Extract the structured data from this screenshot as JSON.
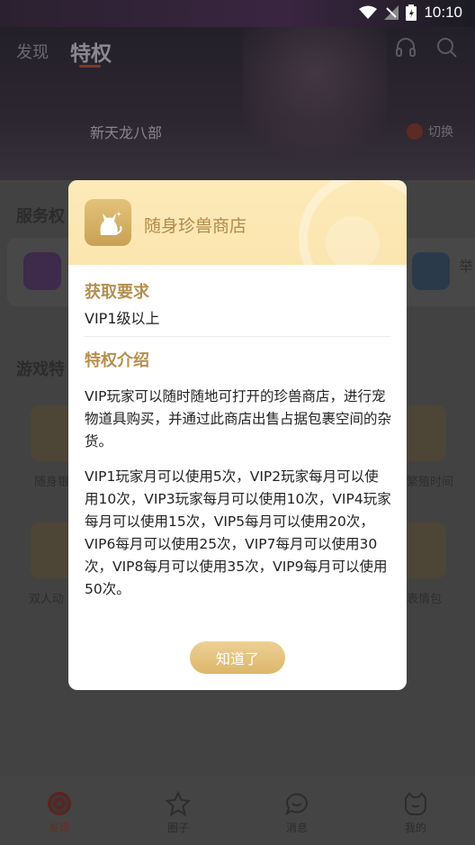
{
  "status_bar": {
    "time": "10:10"
  },
  "header": {
    "tabs": [
      {
        "label": "发现"
      },
      {
        "label": "特权"
      }
    ],
    "server_name": "新天龙八部",
    "switch_label": "切换"
  },
  "background": {
    "service_title": "服务权",
    "service_side_label": "举",
    "game_title": "游戏特",
    "grid_labels": [
      "随身银",
      "繁殖时间",
      "双人动",
      "表情包"
    ]
  },
  "dialog": {
    "title": "随身珍兽商店",
    "requirement_title": "获取要求",
    "requirement_value": "VIP1级以上",
    "intro_title": "特权介绍",
    "intro_paragraph_1": "VIP玩家可以随时随地可打开的珍兽商店，进行宠物道具购买，并通过此商店出售占据包裹空间的杂货。",
    "intro_paragraph_2": "VIP1玩家月可以使用5次，VIP2玩家每月可以使用10次，VIP3玩家每月可以使用10次，VIP4玩家每月可以使用15次，VIP5每月可以使用20次，VIP6每月可以使用25次，VIP7每月可以使用30次，VIP8每月可以使用35次，VIP9每月可以使用50次。",
    "ok_label": "知道了"
  },
  "bottom_nav": [
    {
      "label": "发现",
      "icon": "discover-icon",
      "active": true
    },
    {
      "label": "圈子",
      "icon": "star-icon",
      "active": false
    },
    {
      "label": "消息",
      "icon": "message-icon",
      "active": false
    },
    {
      "label": "我的",
      "icon": "profile-icon",
      "active": false
    }
  ],
  "colors": {
    "accent_gold": "#b58f4f",
    "button_gold": "#dcb66a",
    "active_red": "#c8372d"
  }
}
